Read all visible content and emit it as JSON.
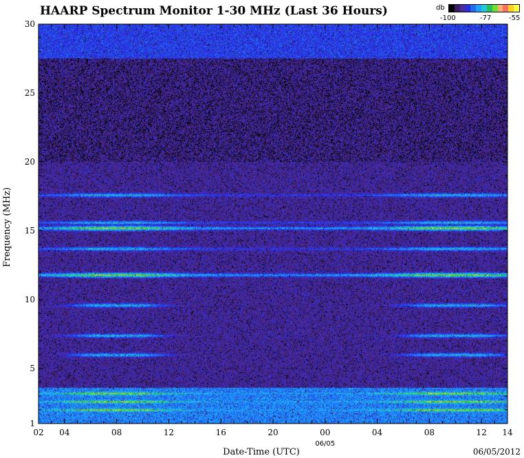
{
  "title": "HAARP Spectrum Monitor 1-30 MHz (Last 36 Hours)",
  "legend": {
    "unit": "db",
    "min_label": "-100",
    "mid_label": "-77",
    "max_label": "-55",
    "colors": [
      "#000000",
      "#3a1f66",
      "#4a2aa0",
      "#2b2ee0",
      "#1f6cf0",
      "#1fa0ff",
      "#22c7d8",
      "#22c060",
      "#70e030",
      "#ffb070",
      "#ff7060",
      "#ffd020",
      "#ffff40"
    ]
  },
  "timestamp": "06/05/2012",
  "chart_data": {
    "type": "heatmap",
    "title": "HAARP Spectrum Monitor 1-30 MHz (Last 36 Hours)",
    "xlabel": "Date-Time (UTC)",
    "ylabel": "Frequency (MHz)",
    "ylim": [
      1,
      30
    ],
    "y_ticks": [
      "1",
      "5",
      "10",
      "15",
      "20",
      "25",
      "30"
    ],
    "y_tick_values": [
      1,
      5,
      10,
      15,
      20,
      25,
      30
    ],
    "x_ticks": [
      "02",
      "04",
      "08",
      "12",
      "16",
      "20",
      "00",
      "04",
      "08",
      "12",
      "14"
    ],
    "x_tick_hours": [
      0,
      2,
      6,
      10,
      14,
      18,
      22,
      26,
      30,
      34,
      36
    ],
    "x_range_hours": [
      0,
      36
    ],
    "date_marker": "06/05",
    "date_marker_hour": 22,
    "colorbar_range_db": [
      -100,
      -55
    ],
    "bands_mhz": [
      {
        "freq": 2.0,
        "level": "strong",
        "span": "full"
      },
      {
        "freq": 2.6,
        "level": "strong",
        "span": "full"
      },
      {
        "freq": 3.2,
        "level": "strong",
        "span": "full"
      },
      {
        "freq": 6.0,
        "level": "medium",
        "span": "day"
      },
      {
        "freq": 7.4,
        "level": "medium",
        "span": "day"
      },
      {
        "freq": 9.6,
        "level": "medium",
        "span": "day"
      },
      {
        "freq": 11.8,
        "level": "strong",
        "span": "full"
      },
      {
        "freq": 13.7,
        "level": "medium",
        "span": "full"
      },
      {
        "freq": 15.2,
        "level": "strong",
        "span": "full"
      },
      {
        "freq": 15.6,
        "level": "medium",
        "span": "full"
      },
      {
        "freq": 17.6,
        "level": "medium",
        "span": "full"
      },
      {
        "freq": 29.3,
        "level": "weak",
        "span": "full"
      }
    ]
  }
}
